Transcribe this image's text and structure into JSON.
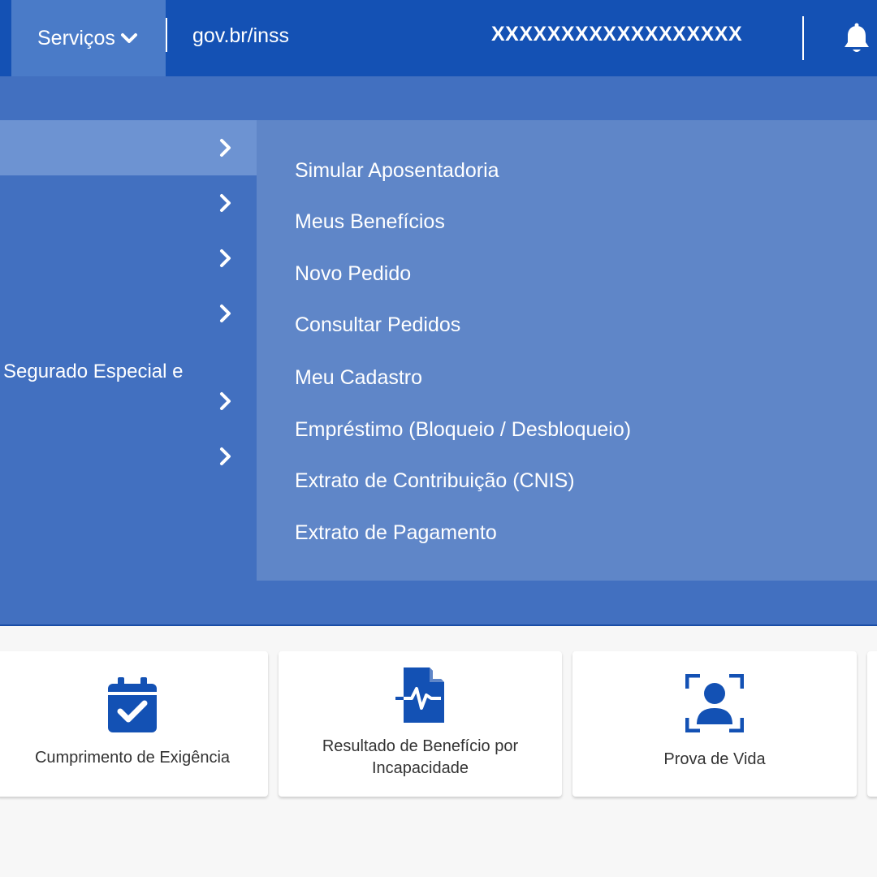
{
  "header": {
    "services_label": "Serviços",
    "site_url": "gov.br/inss",
    "user_name": "XXXXXXXXXXXXXXXXXX",
    "icons": [
      "chevron-down-icon",
      "bell-icon"
    ]
  },
  "left_menu": {
    "items": [
      {
        "label": ""
      },
      {
        "label": ""
      },
      {
        "label": ""
      },
      {
        "label": ""
      },
      {
        "label": "Segurado Especial e"
      },
      {
        "label": ""
      },
      {
        "label": ""
      }
    ]
  },
  "submenu": {
    "items": [
      {
        "label": "Simular Aposentadoria"
      },
      {
        "label": "Meus Benefícios"
      },
      {
        "label": "Novo Pedido"
      },
      {
        "label": "Consultar Pedidos"
      },
      {
        "label": "Meu Cadastro"
      },
      {
        "label": "Empréstimo (Bloqueio / Desbloqueio)"
      },
      {
        "label": "Extrato de Contribuição (CNIS)"
      },
      {
        "label": "Extrato de Pagamento"
      }
    ]
  },
  "cards": [
    {
      "title": "Cumprimento de Exigência",
      "icon": "calendar-check-icon"
    },
    {
      "title_line1": "Resultado de Benefício por",
      "title_line2": "Incapacidade",
      "icon": "medical-document-icon"
    },
    {
      "title": "Prova de Vida",
      "icon": "face-scan-icon"
    }
  ],
  "colors": {
    "header_bg": "#1451b4",
    "menu_bg": "#4270c0",
    "submenu_bg": "#5f86c8",
    "icon_blue": "#1351b4"
  }
}
